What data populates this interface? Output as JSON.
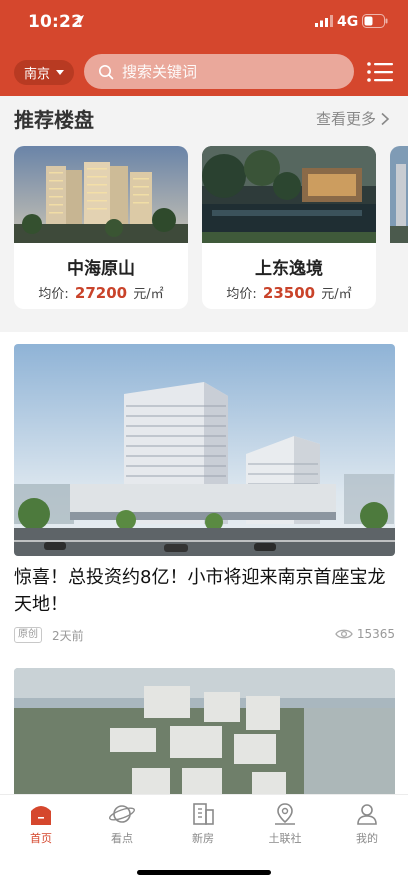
{
  "status_bar": {
    "time": "10:22",
    "network": "4G"
  },
  "header": {
    "city": "南京",
    "search_placeholder": "搜索关键词"
  },
  "recommended": {
    "title": "推荐楼盘",
    "more_label": "查看更多",
    "properties": [
      {
        "name": "中海原山",
        "price_label": "均价:",
        "price": "27200",
        "unit": "元/㎡"
      },
      {
        "name": "上东逸境",
        "price_label": "均价:",
        "price": "23500",
        "unit": "元/㎡"
      }
    ]
  },
  "news": [
    {
      "title": "惊喜！总投资约8亿！小市将迎来南京首座宝龙天地！",
      "tag": "原创",
      "time": "2天前",
      "views": "15365"
    }
  ],
  "tabbar": {
    "items": [
      {
        "label": "首页",
        "icon": "home-icon",
        "active": true
      },
      {
        "label": "看点",
        "icon": "planet-icon",
        "active": false
      },
      {
        "label": "新房",
        "icon": "building-icon",
        "active": false
      },
      {
        "label": "土联社",
        "icon": "location-icon",
        "active": false
      },
      {
        "label": "我的",
        "icon": "user-icon",
        "active": false
      }
    ]
  },
  "colors": {
    "brand": "#d5472d",
    "price": "#c9432a"
  }
}
